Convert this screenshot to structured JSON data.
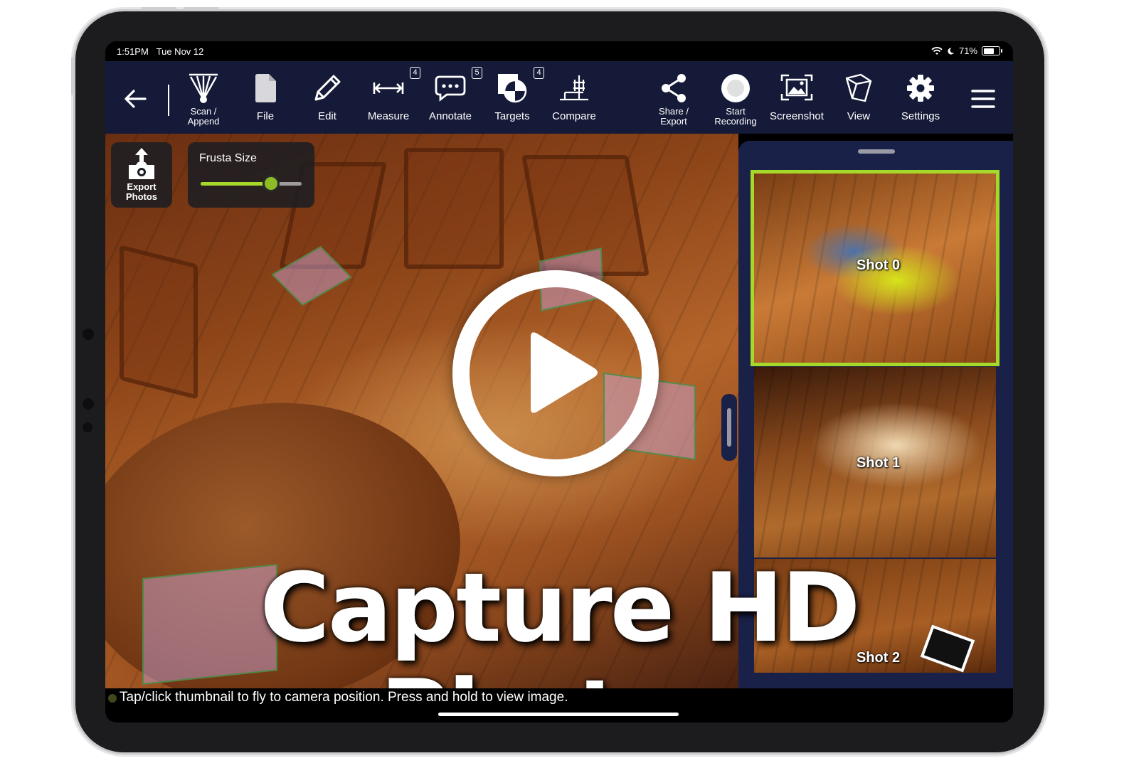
{
  "status_bar": {
    "time": "1:51PM",
    "date": "Tue Nov 12",
    "battery": "71%",
    "battery_level": 0.71
  },
  "toolbar": {
    "back_icon": "back-arrow-icon",
    "items": [
      {
        "label": "Scan / Append",
        "icon": "scan-icon"
      },
      {
        "label": "File",
        "icon": "file-icon"
      },
      {
        "label": "Edit",
        "icon": "pencil-icon"
      },
      {
        "label": "Measure",
        "icon": "measure-icon",
        "badge": "4"
      },
      {
        "label": "Annotate",
        "icon": "speech-bubble-icon",
        "badge": "5"
      },
      {
        "label": "Targets",
        "icon": "target-icon",
        "badge": "4"
      },
      {
        "label": "Compare",
        "icon": "compare-icon"
      },
      {
        "label": "Share / Export",
        "icon": "share-icon"
      },
      {
        "label": "Start Recording",
        "icon": "record-icon"
      },
      {
        "label": "Screenshot",
        "icon": "screenshot-icon"
      },
      {
        "label": "View",
        "icon": "cube-icon"
      },
      {
        "label": "Settings",
        "icon": "gear-icon"
      }
    ],
    "menu_icon": "hamburger-menu-icon"
  },
  "viewport": {
    "export_photos_label": "Export Photos",
    "frusta_size_label": "Frusta Size",
    "frusta_size_value": 0.7
  },
  "thumbnails": {
    "shots": [
      {
        "label": "Shot 0",
        "selected": true
      },
      {
        "label": "Shot 1",
        "selected": false
      },
      {
        "label": "Shot 2",
        "selected": false
      }
    ]
  },
  "overlay": {
    "headline": "Capture HD Photos",
    "play_icon": "play-icon"
  },
  "hint": {
    "text": "Tap/click thumbnail to fly to camera position. Press and hold to view image."
  },
  "colors": {
    "toolbar_bg": "#151a38",
    "accent": "#a6d82a",
    "panel_bg": "#1a2148"
  }
}
